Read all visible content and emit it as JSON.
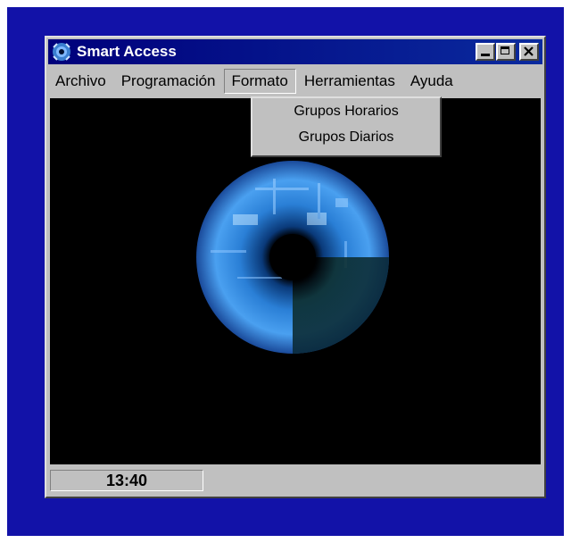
{
  "window": {
    "title": "Smart Access",
    "icon": "eye-icon",
    "controls": {
      "minimize": "minimize-icon",
      "maximize": "maximize-icon",
      "close": "close-icon"
    }
  },
  "menubar": {
    "items": [
      {
        "label": "Archivo"
      },
      {
        "label": "Programación"
      },
      {
        "label": "Formato"
      },
      {
        "label": "Herramientas"
      },
      {
        "label": "Ayuda"
      }
    ],
    "open_menu": "Formato"
  },
  "dropdown": {
    "items": [
      {
        "label": "Grupos Horarios"
      },
      {
        "label": "Grupos Diarios"
      }
    ]
  },
  "client": {
    "image": "blue-iris-eye"
  },
  "statusbar": {
    "time": "13:40"
  },
  "colors": {
    "desktop": "#1212a8",
    "titlebar": "#00007b",
    "chrome": "#c0c0c0",
    "client": "#000000"
  }
}
